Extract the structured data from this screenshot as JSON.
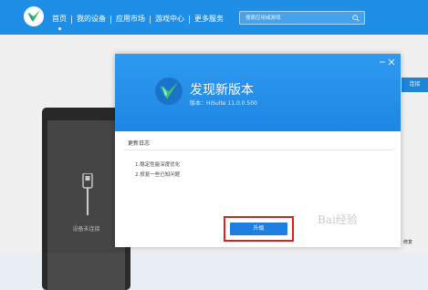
{
  "topbar": {
    "nav": [
      "首页",
      "我的设备",
      "应用市场",
      "游戏中心",
      "更多服务"
    ],
    "search_placeholder": "搜索应用或游戏"
  },
  "background": {
    "phone_label": "设备未连接",
    "right_button": "连接",
    "right_footer": "修复"
  },
  "dialog": {
    "title": "发现新版本",
    "version": "版本：HiSuite 11.0.0.500",
    "log_title": "更新日志",
    "log_items": [
      "1.稳定性能深度优化",
      "2.修复一些已知问题"
    ],
    "upgrade_label": "升级"
  },
  "watermark": "Bai经验",
  "colors": {
    "brand_blue": "#1f8ee6",
    "highlight_red": "#e02020"
  }
}
